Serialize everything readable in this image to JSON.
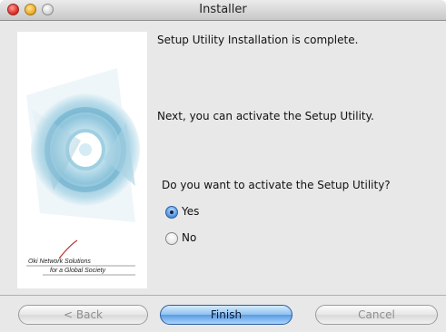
{
  "window": {
    "title": "Installer"
  },
  "content": {
    "line1": "Setup Utility Installation is complete.",
    "line2": "Next, you can activate the Setup Utility.",
    "question": "Do you want to activate the Setup Utility?"
  },
  "options": [
    {
      "label": "Yes",
      "selected": true
    },
    {
      "label": "No",
      "selected": false
    }
  ],
  "logo": {
    "line1": "Oki Network Solutions",
    "line2": "for a Global Society"
  },
  "buttons": {
    "back": "< Back",
    "finish": "Finish",
    "cancel": "Cancel"
  },
  "colors": {
    "window_bg": "#e8e8e8",
    "default_button": "#5a9be1"
  }
}
